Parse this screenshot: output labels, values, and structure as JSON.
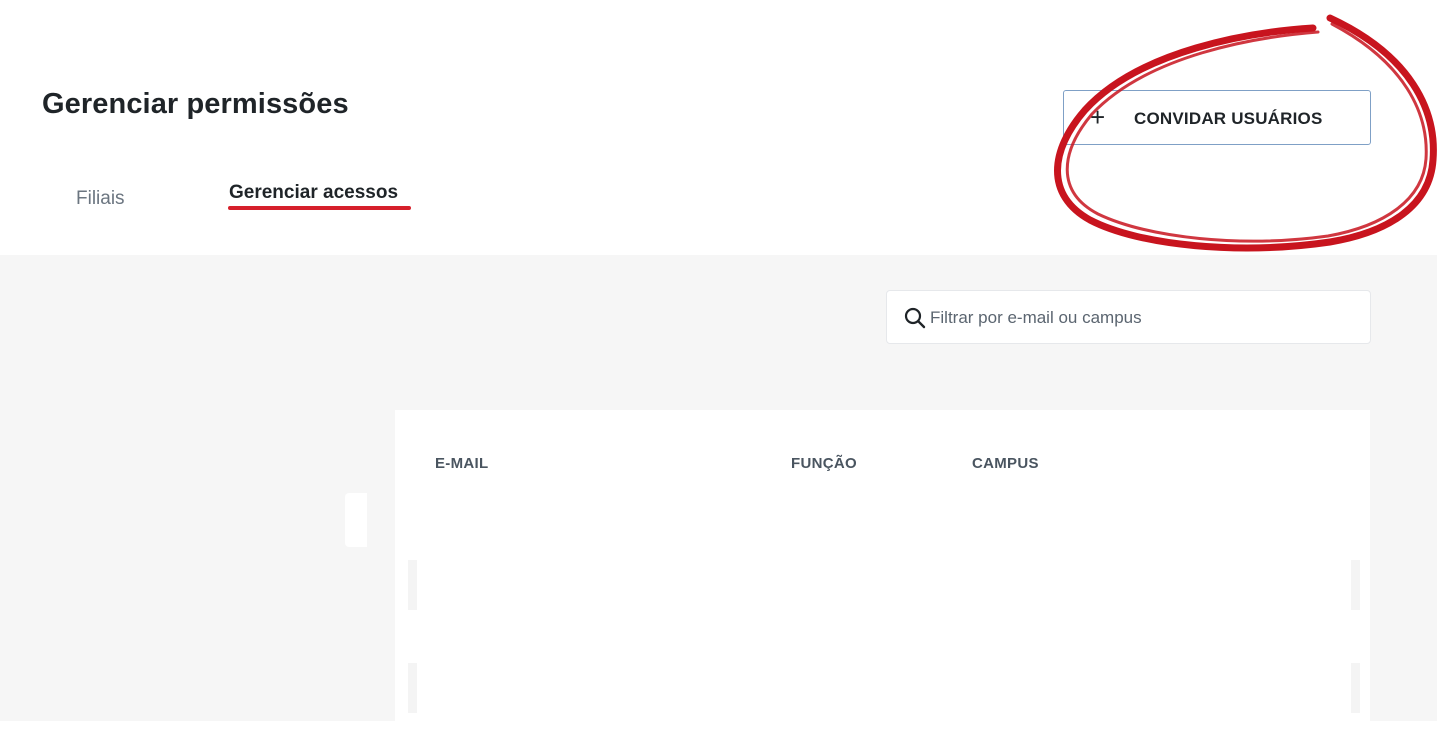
{
  "header": {
    "title": "Gerenciar permissões",
    "invite_button": {
      "icon": "plus-icon",
      "label": "CONVIDAR USUÁRIOS"
    }
  },
  "tabs": [
    {
      "label": "Filiais",
      "active": false
    },
    {
      "label": "Gerenciar acessos",
      "active": true
    }
  ],
  "search": {
    "placeholder": "Filtrar por e-mail ou campus",
    "value": ""
  },
  "table": {
    "columns": [
      "E-MAIL",
      "FUNÇÃO",
      "CAMPUS"
    ],
    "rows": []
  },
  "colors": {
    "accent": "#d6202b",
    "annotation": "#c8141e",
    "button_border": "#7fa0c6",
    "content_background": "#f6f6f6"
  }
}
